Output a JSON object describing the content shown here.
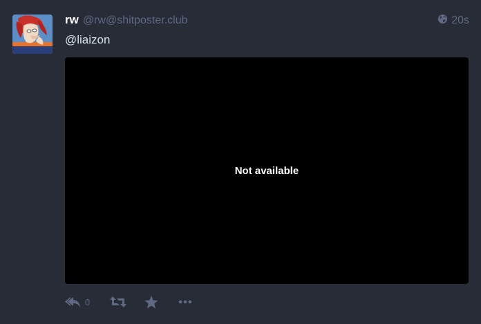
{
  "status": {
    "display_name": "rw",
    "account": "@rw@shitposter.club",
    "visibility_icon": "globe-icon",
    "timestamp": "20s",
    "content": "@liaizon",
    "media": {
      "message": "Not available",
      "background": "#000000"
    },
    "actions": {
      "reply_icon": "reply-all-icon",
      "reply_count": "0",
      "boost_icon": "retweet-icon",
      "favourite_icon": "star-icon",
      "more_icon": "ellipsis-icon"
    }
  },
  "colors": {
    "background": "#282c37",
    "muted": "#606984",
    "text": "#d9e1e8",
    "name": "#ffffff"
  }
}
